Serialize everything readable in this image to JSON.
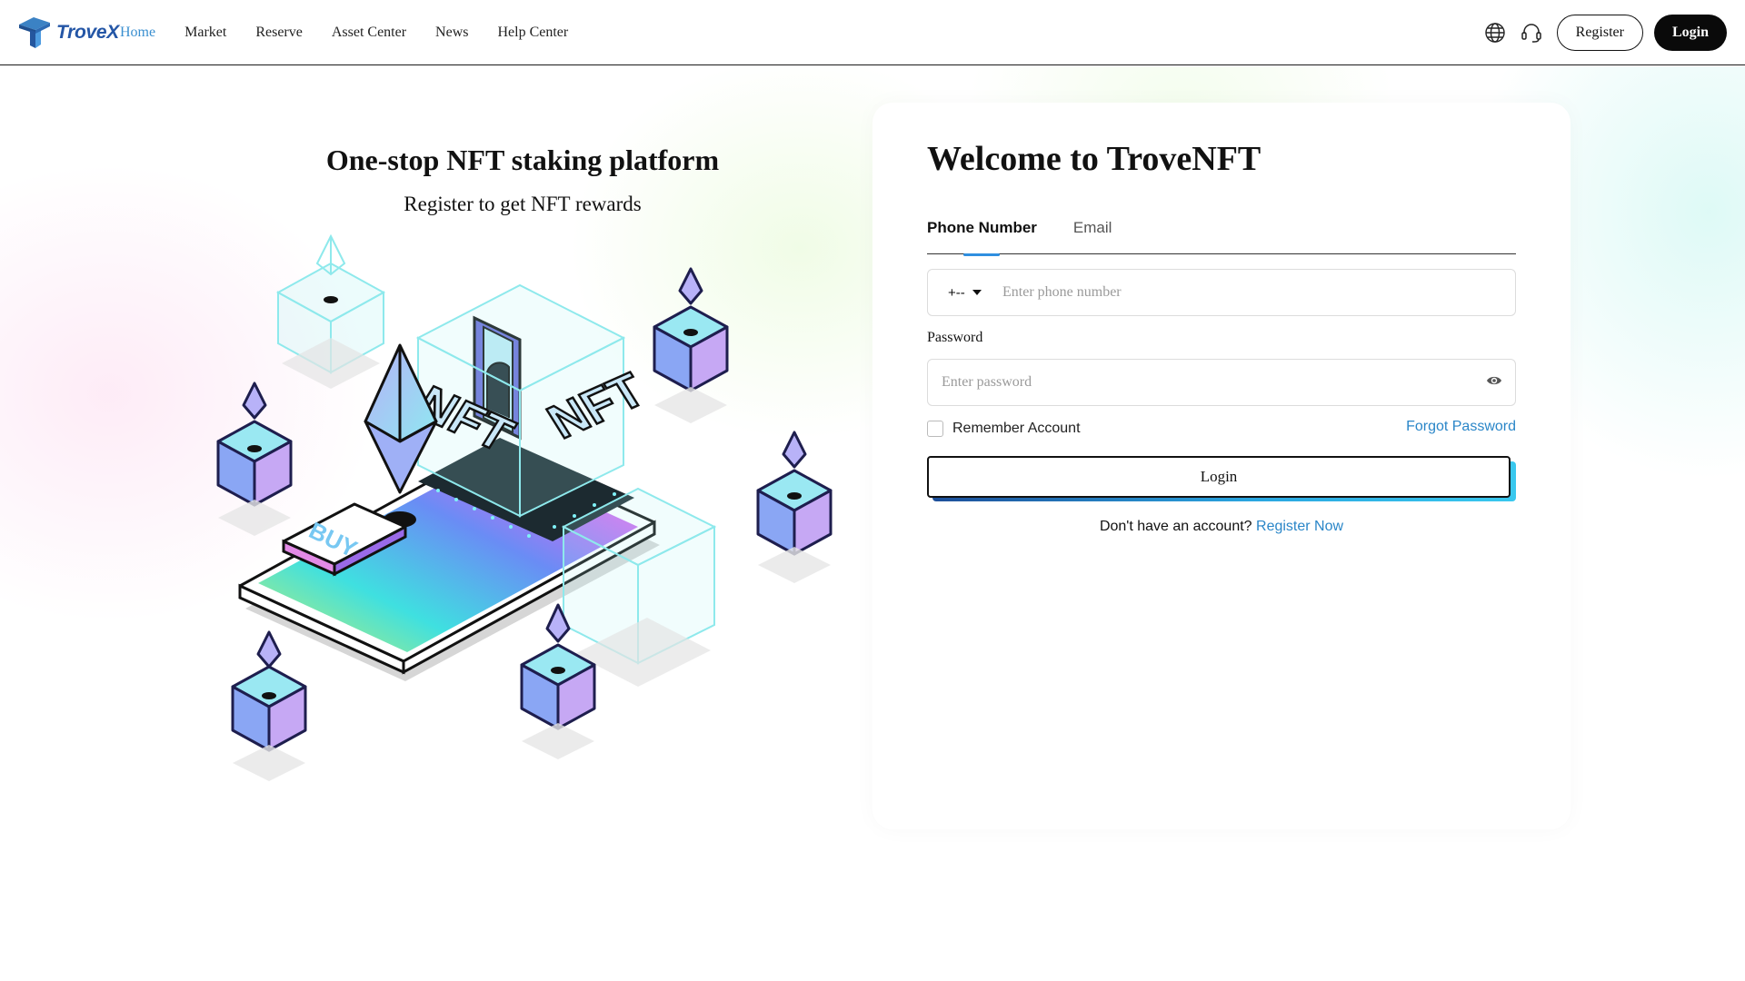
{
  "brand": {
    "name": "TroveX"
  },
  "nav": {
    "items": [
      {
        "label": "Home",
        "active": true
      },
      {
        "label": "Market"
      },
      {
        "label": "Reserve"
      },
      {
        "label": "Asset Center"
      },
      {
        "label": "News"
      },
      {
        "label": "Help Center"
      }
    ],
    "register_label": "Register",
    "login_label": "Login",
    "icons": [
      "globe-icon",
      "headset-icon"
    ]
  },
  "hero": {
    "title": "One-stop NFT staking platform",
    "subtitle": "Register to get NFT rewards",
    "illustration_text": {
      "nft": "NFT",
      "buy": "BUY"
    }
  },
  "login_card": {
    "title": "Welcome to TroveNFT",
    "tabs": [
      {
        "label": "Phone Number",
        "active": true
      },
      {
        "label": "Email"
      }
    ],
    "phone": {
      "country_code": "+--",
      "placeholder": "Enter phone number"
    },
    "password": {
      "label": "Password",
      "placeholder": "Enter password"
    },
    "remember_label": "Remember Account",
    "forgot_label": "Forgot Password",
    "login_label": "Login",
    "signup_prompt": "Don't have an account?",
    "signup_link": "Register Now"
  },
  "colors": {
    "accent": "#2a86c8",
    "brand": "#2456a6",
    "active_nav": "#3a8fd0"
  }
}
